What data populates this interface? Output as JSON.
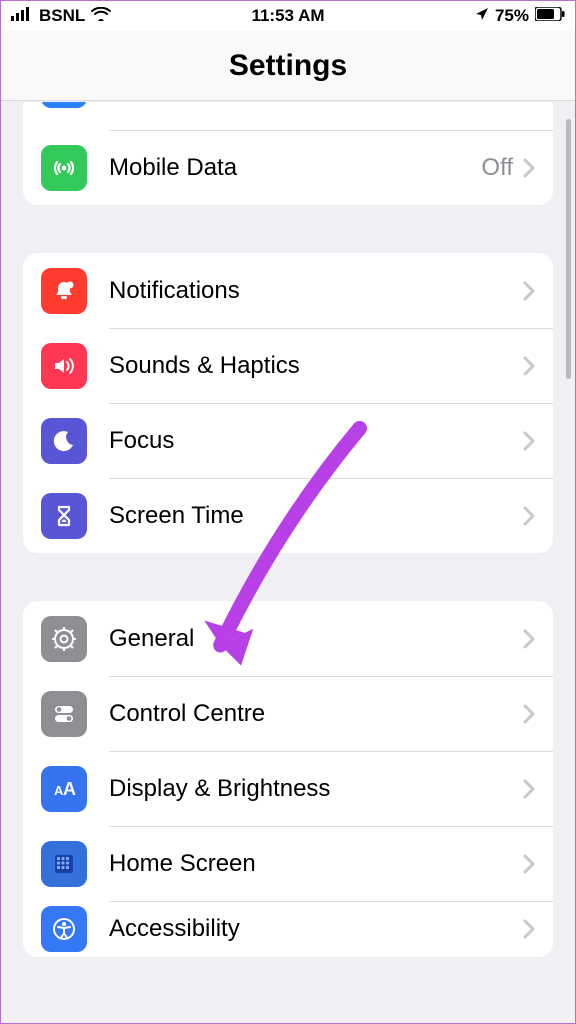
{
  "statusbar": {
    "carrier": "BSNL",
    "time": "11:53 AM",
    "battery": "75%"
  },
  "header": {
    "title": "Settings"
  },
  "group1": {
    "mobile_data": {
      "label": "Mobile Data",
      "value": "Off"
    }
  },
  "group2": {
    "notifications": {
      "label": "Notifications"
    },
    "sounds": {
      "label": "Sounds & Haptics"
    },
    "focus": {
      "label": "Focus"
    },
    "screentime": {
      "label": "Screen Time"
    }
  },
  "group3": {
    "general": {
      "label": "General"
    },
    "controlcentre": {
      "label": "Control Centre"
    },
    "display": {
      "label": "Display & Brightness"
    },
    "homescreen": {
      "label": "Home Screen"
    },
    "accessibility": {
      "label": "Accessibility"
    }
  }
}
